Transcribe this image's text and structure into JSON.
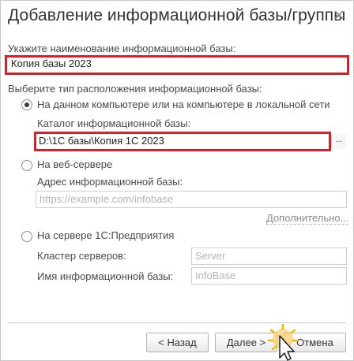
{
  "dialog": {
    "title": "Добавление информационной базы/группы",
    "close_glyph": "×"
  },
  "name_section": {
    "label": "Укажите наименование информационной базы:",
    "value": "Копия базы 2023"
  },
  "location_section": {
    "label": "Выберите тип расположения информационной базы:",
    "options": [
      {
        "label": "На данном компьютере или на компьютере в локальной сети",
        "selected": true
      },
      {
        "label": "На веб-сервере",
        "selected": false
      },
      {
        "label": "На сервере 1С:Предприятия",
        "selected": false
      }
    ],
    "local": {
      "catalog_label": "Каталог информационной базы:",
      "catalog_value": "D:\\1С базы\\Копия 1С 2023",
      "browse_label": "..."
    },
    "web": {
      "address_label": "Адрес информационной базы:",
      "address_placeholder": "https://example.com/infobase",
      "more_link": "Дополнительно..."
    },
    "server": {
      "cluster_label": "Кластер серверов:",
      "cluster_placeholder": "Server",
      "ib_name_label": "Имя информационной базы:",
      "ib_name_placeholder": "InfoBase"
    }
  },
  "buttons": {
    "back": "< Назад",
    "next": "Далее >",
    "cancel": "Отмена"
  },
  "colors": {
    "highlight": "#d2222a",
    "cursor_glow": "#f5c242"
  },
  "icons": {
    "cursor": "mouse-pointer-with-click-glow"
  }
}
